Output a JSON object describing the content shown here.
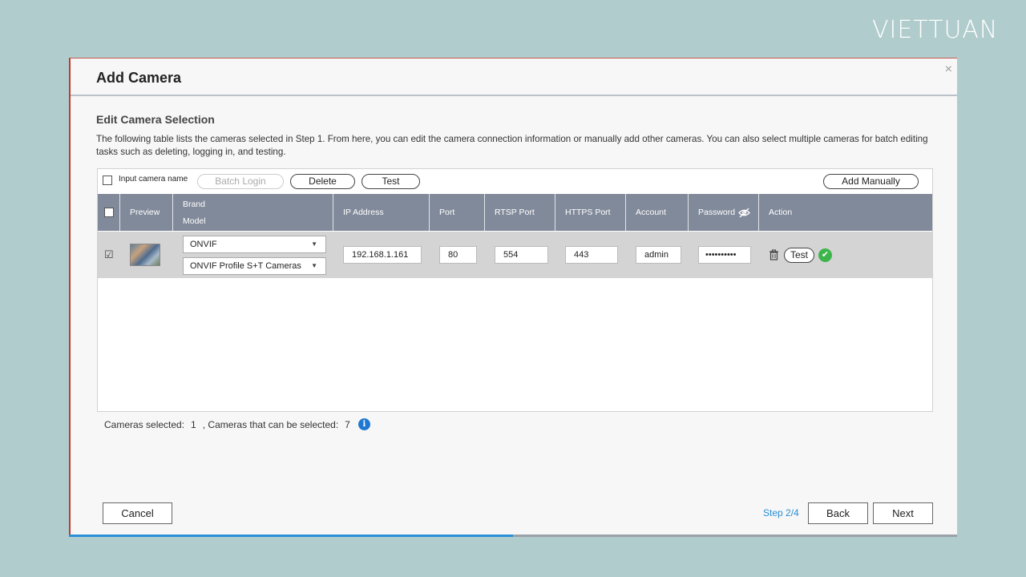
{
  "watermark": {
    "logo_text": "VIETTUAN"
  },
  "dialog": {
    "title": "Add Camera",
    "close_glyph": "×",
    "section_title": "Edit Camera Selection",
    "description": "The following table lists the cameras selected in Step 1. From here, you can edit the camera connection information or manually add other cameras. You can also select multiple cameras for batch editing tasks such as deleting, logging in, and testing."
  },
  "toolbar": {
    "input_camera_name_label": "Input camera name",
    "batch_login": "Batch Login",
    "delete": "Delete",
    "test": "Test",
    "add_manually": "Add Manually"
  },
  "table": {
    "headers": {
      "preview": "Preview",
      "brand": "Brand",
      "model": "Model",
      "ip": "IP Address",
      "port": "Port",
      "rtsp": "RTSP Port",
      "https": "HTTPS Port",
      "account": "Account",
      "password": "Password",
      "action": "Action"
    },
    "rows": [
      {
        "checked": "☑",
        "brand": "ONVIF",
        "model": "ONVIF Profile S+T Cameras",
        "ip": "192.168.1.161",
        "port": "80",
        "rtsp": "554",
        "https": "443",
        "account": "admin",
        "password": "••••••••••",
        "test_label": "Test",
        "status": "connected"
      }
    ]
  },
  "footer": {
    "cameras_selected_label": "Cameras selected:",
    "cameras_selected_value": "1",
    "cameras_selectable_label": ", Cameras that can be selected:",
    "cameras_selectable_value": "7",
    "cancel": "Cancel",
    "step": "Step 2/4",
    "back": "Back",
    "next": "Next"
  },
  "progress": {
    "fraction": 0.5,
    "fill_color": "#2a8fd6"
  },
  "colors": {
    "header_bg": "#818a9a",
    "row_bg": "#d4d4d4",
    "accent": "#2a8fd6",
    "ok": "#3db54a"
  }
}
